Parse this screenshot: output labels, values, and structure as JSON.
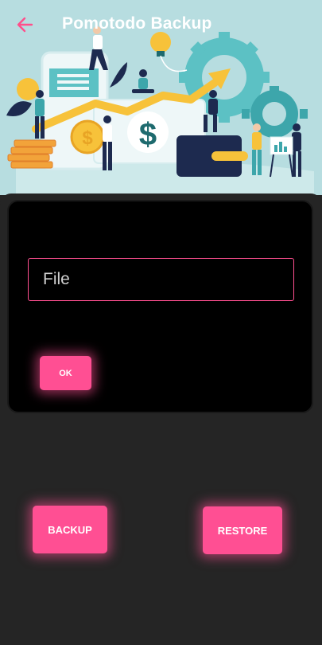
{
  "header": {
    "title": "Pomotodo Backup",
    "back_icon": "arrow-left-icon",
    "accent": "#ff4f8b",
    "background": "#b7dde0"
  },
  "illustration": {
    "dollar_symbol": "$"
  },
  "card": {
    "file_input": {
      "placeholder": "File",
      "value": ""
    },
    "ok_label": "OK"
  },
  "actions": {
    "backup_label": "BACKUP",
    "restore_label": "RESTORE"
  },
  "colors": {
    "button": "#ff4f93",
    "panel": "#252525",
    "card": "#000000"
  }
}
